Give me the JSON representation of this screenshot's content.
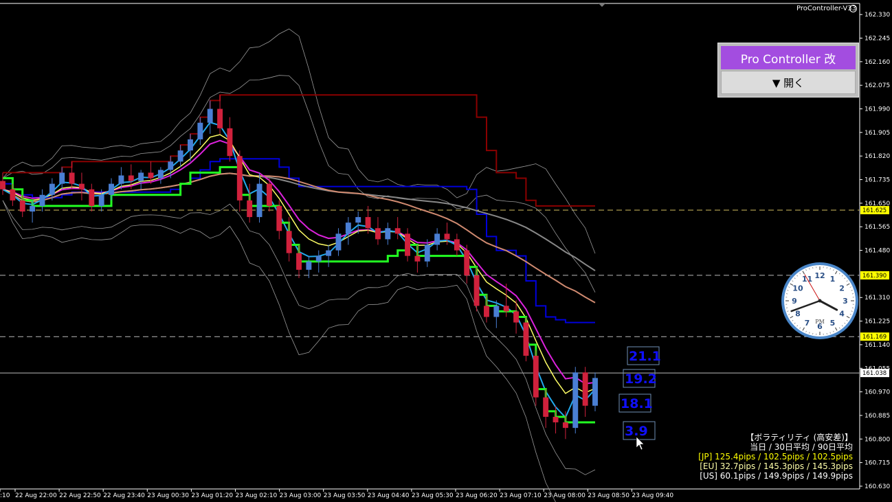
{
  "indicator_title": "ProController-V33",
  "pro_controller": {
    "title": "Pro Controller 改",
    "open_button": "▼ 開く"
  },
  "volatility": {
    "heading": "【ボラティリティ (高安差)】",
    "subheading": "当日 / 30日平均 / 90日平均",
    "jp": "[JP] 125.4pips / 102.5pips / 102.5pips",
    "eu": "[EU] 32.7pips / 145.3pips / 145.3pips",
    "us": "[US] 60.1pips / 149.9pips / 149.9pips"
  },
  "clock": {
    "numerals": [
      "12",
      "1",
      "2",
      "3",
      "4",
      "5",
      "6",
      "7",
      "8",
      "9",
      "10",
      "11"
    ],
    "label": "PM",
    "hour_hand_deg": 118,
    "minute_hand_deg": 250,
    "second_hand_deg": 330
  },
  "colors": {
    "background": "#000000",
    "bull_candle": "#4a7fd4",
    "bear_candle": "#d0213c",
    "ma_green": "#22ff22",
    "ma_yellow": "#ffff66",
    "ma_magenta": "#dd22dd",
    "ma_cyan": "#22aaee",
    "ma_salmon": "#d08a70",
    "ma_gray": "#888888",
    "band_white": "#cccccc",
    "level_darkred": "#8b0000",
    "level_blue": "#0000dd",
    "hline_yellow": "#d4c060",
    "hline_gray": "#bbbbbb",
    "tag_yellow": "#ffff00",
    "tag_white": "#ffffff"
  },
  "chart_data": {
    "type": "line",
    "symbol_note": "candlestick price chart with moving averages and bands",
    "y_axis": {
      "ticks": [
        "162.330",
        "162.245",
        "162.160",
        "162.075",
        "161.990",
        "161.905",
        "161.820",
        "161.735",
        "161.650",
        "161.565",
        "161.480",
        "161.310",
        "161.225",
        "161.140",
        "161.055",
        "160.970",
        "160.885",
        "160.800",
        "160.715",
        "160.630"
      ],
      "ylim": [
        160.62,
        162.37
      ]
    },
    "x_axis": {
      "ticks": [
        ":10",
        "22 Aug 22:00",
        "22 Aug 22:50",
        "22 Aug 23:40",
        "23 Aug 00:30",
        "23 Aug 01:20",
        "23 Aug 02:10",
        "23 Aug 03:00",
        "23 Aug 03:50",
        "23 Aug 04:40",
        "23 Aug 05:30",
        "23 Aug 06:20",
        "23 Aug 07:10",
        "23 Aug 08:00",
        "23 Aug 08:50",
        "23 Aug 09:40"
      ]
    },
    "price_tags": [
      {
        "value": 161.625,
        "label": "161.625",
        "style": "yellow"
      },
      {
        "value": 161.39,
        "label": "161.390",
        "style": "yellow"
      },
      {
        "value": 161.169,
        "label": "161.169",
        "style": "yellow"
      },
      {
        "value": 161.038,
        "label": "161.038",
        "style": "white"
      }
    ],
    "horizontal_lines": [
      {
        "value": 161.625,
        "style": "dashed",
        "color": "hline_yellow"
      },
      {
        "value": 161.39,
        "style": "dashed",
        "color": "hline_gray"
      },
      {
        "value": 161.169,
        "style": "dashed",
        "color": "hline_gray"
      },
      {
        "value": 161.038,
        "style": "solid",
        "color": "hline_gray"
      }
    ],
    "volatility_boxes": [
      "21.1",
      "19.2",
      "18.1",
      "3.9"
    ],
    "candles": [
      {
        "o": 161.73,
        "h": 161.76,
        "l": 161.68,
        "c": 161.7
      },
      {
        "o": 161.7,
        "h": 161.72,
        "l": 161.64,
        "c": 161.66
      },
      {
        "o": 161.66,
        "h": 161.68,
        "l": 161.6,
        "c": 161.62
      },
      {
        "o": 161.62,
        "h": 161.66,
        "l": 161.58,
        "c": 161.64
      },
      {
        "o": 161.64,
        "h": 161.7,
        "l": 161.62,
        "c": 161.68
      },
      {
        "o": 161.68,
        "h": 161.74,
        "l": 161.66,
        "c": 161.72
      },
      {
        "o": 161.72,
        "h": 161.78,
        "l": 161.7,
        "c": 161.76
      },
      {
        "o": 161.76,
        "h": 161.8,
        "l": 161.7,
        "c": 161.72
      },
      {
        "o": 161.72,
        "h": 161.76,
        "l": 161.66,
        "c": 161.7
      },
      {
        "o": 161.7,
        "h": 161.72,
        "l": 161.62,
        "c": 161.64
      },
      {
        "o": 161.64,
        "h": 161.7,
        "l": 161.62,
        "c": 161.68
      },
      {
        "o": 161.68,
        "h": 161.74,
        "l": 161.66,
        "c": 161.72
      },
      {
        "o": 161.72,
        "h": 161.78,
        "l": 161.7,
        "c": 161.75
      },
      {
        "o": 161.75,
        "h": 161.79,
        "l": 161.7,
        "c": 161.73
      },
      {
        "o": 161.73,
        "h": 161.77,
        "l": 161.7,
        "c": 161.76
      },
      {
        "o": 161.76,
        "h": 161.8,
        "l": 161.72,
        "c": 161.74
      },
      {
        "o": 161.74,
        "h": 161.78,
        "l": 161.72,
        "c": 161.77
      },
      {
        "o": 161.77,
        "h": 161.82,
        "l": 161.74,
        "c": 161.8
      },
      {
        "o": 161.8,
        "h": 161.86,
        "l": 161.78,
        "c": 161.84
      },
      {
        "o": 161.84,
        "h": 161.9,
        "l": 161.8,
        "c": 161.88
      },
      {
        "o": 161.88,
        "h": 161.96,
        "l": 161.86,
        "c": 161.94
      },
      {
        "o": 161.94,
        "h": 162.02,
        "l": 161.9,
        "c": 161.99
      },
      {
        "o": 161.99,
        "h": 162.04,
        "l": 161.9,
        "c": 161.92
      },
      {
        "o": 161.92,
        "h": 161.96,
        "l": 161.8,
        "c": 161.82
      },
      {
        "o": 161.82,
        "h": 161.84,
        "l": 161.62,
        "c": 161.66
      },
      {
        "o": 161.66,
        "h": 161.72,
        "l": 161.58,
        "c": 161.6
      },
      {
        "o": 161.6,
        "h": 161.76,
        "l": 161.58,
        "c": 161.72
      },
      {
        "o": 161.72,
        "h": 161.74,
        "l": 161.62,
        "c": 161.64
      },
      {
        "o": 161.64,
        "h": 161.66,
        "l": 161.52,
        "c": 161.55
      },
      {
        "o": 161.55,
        "h": 161.6,
        "l": 161.44,
        "c": 161.47
      },
      {
        "o": 161.47,
        "h": 161.5,
        "l": 161.38,
        "c": 161.41
      },
      {
        "o": 161.41,
        "h": 161.46,
        "l": 161.38,
        "c": 161.44
      },
      {
        "o": 161.44,
        "h": 161.48,
        "l": 161.4,
        "c": 161.46
      },
      {
        "o": 161.46,
        "h": 161.5,
        "l": 161.42,
        "c": 161.48
      },
      {
        "o": 161.48,
        "h": 161.56,
        "l": 161.46,
        "c": 161.54
      },
      {
        "o": 161.54,
        "h": 161.6,
        "l": 161.5,
        "c": 161.58
      },
      {
        "o": 161.58,
        "h": 161.62,
        "l": 161.54,
        "c": 161.6
      },
      {
        "o": 161.6,
        "h": 161.64,
        "l": 161.54,
        "c": 161.56
      },
      {
        "o": 161.56,
        "h": 161.6,
        "l": 161.5,
        "c": 161.52
      },
      {
        "o": 161.52,
        "h": 161.58,
        "l": 161.5,
        "c": 161.56
      },
      {
        "o": 161.56,
        "h": 161.6,
        "l": 161.52,
        "c": 161.54
      },
      {
        "o": 161.54,
        "h": 161.56,
        "l": 161.44,
        "c": 161.46
      },
      {
        "o": 161.46,
        "h": 161.5,
        "l": 161.4,
        "c": 161.44
      },
      {
        "o": 161.44,
        "h": 161.52,
        "l": 161.42,
        "c": 161.5
      },
      {
        "o": 161.5,
        "h": 161.56,
        "l": 161.48,
        "c": 161.54
      },
      {
        "o": 161.54,
        "h": 161.58,
        "l": 161.5,
        "c": 161.52
      },
      {
        "o": 161.52,
        "h": 161.54,
        "l": 161.46,
        "c": 161.48
      },
      {
        "o": 161.48,
        "h": 161.5,
        "l": 161.36,
        "c": 161.39
      },
      {
        "o": 161.39,
        "h": 161.42,
        "l": 161.26,
        "c": 161.28
      },
      {
        "o": 161.28,
        "h": 161.32,
        "l": 161.22,
        "c": 161.24
      },
      {
        "o": 161.24,
        "h": 161.3,
        "l": 161.2,
        "c": 161.28
      },
      {
        "o": 161.28,
        "h": 161.36,
        "l": 161.24,
        "c": 161.26
      },
      {
        "o": 161.26,
        "h": 161.3,
        "l": 161.18,
        "c": 161.22
      },
      {
        "o": 161.22,
        "h": 161.24,
        "l": 161.08,
        "c": 161.1
      },
      {
        "o": 161.1,
        "h": 161.12,
        "l": 160.92,
        "c": 160.95
      },
      {
        "o": 160.95,
        "h": 160.98,
        "l": 160.84,
        "c": 160.88
      },
      {
        "o": 160.88,
        "h": 160.92,
        "l": 160.82,
        "c": 160.86
      },
      {
        "o": 160.86,
        "h": 160.9,
        "l": 160.8,
        "c": 160.84
      },
      {
        "o": 160.84,
        "h": 161.06,
        "l": 160.82,
        "c": 161.04
      },
      {
        "o": 161.04,
        "h": 161.06,
        "l": 160.88,
        "c": 160.92
      },
      {
        "o": 160.92,
        "h": 161.04,
        "l": 160.9,
        "c": 161.02
      }
    ]
  }
}
